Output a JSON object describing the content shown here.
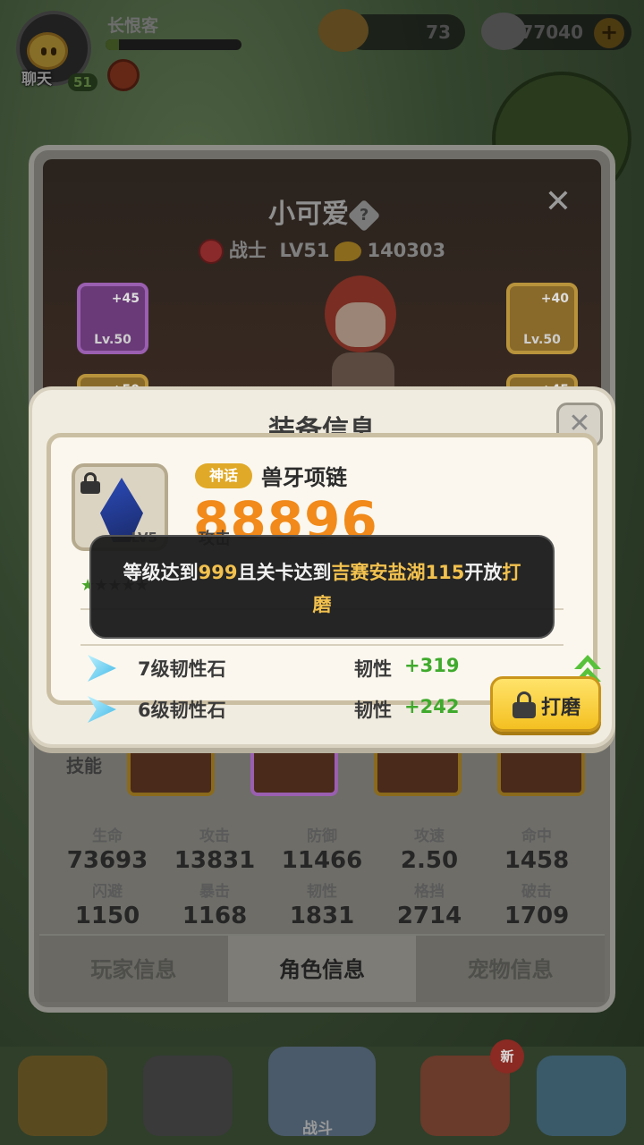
{
  "hud": {
    "player_name": "长恨客",
    "chat_label": "聊天",
    "player_level": "51",
    "exp_progress": 0.1,
    "gold": "73",
    "diamonds": "77040",
    "plus_symbol": "+"
  },
  "character": {
    "name": "小可爱",
    "help_symbol": "?",
    "class_name": "战士",
    "level": "LV51",
    "power": "140303",
    "close_symbol": "✕",
    "equip_left": {
      "bonus": "+45",
      "level": "Lv.50"
    },
    "equip_right": {
      "bonus": "+40",
      "level": "Lv.50"
    },
    "equip_left2": {
      "bonus": "+50"
    },
    "equip_right2": {
      "bonus": "+45"
    },
    "skill_label": "技能",
    "stats": [
      {
        "label": "生命",
        "value": "73693"
      },
      {
        "label": "攻击",
        "value": "13831"
      },
      {
        "label": "防御",
        "value": "11466"
      },
      {
        "label": "攻速",
        "value": "2.50"
      },
      {
        "label": "命中",
        "value": "1458"
      },
      {
        "label": "闪避",
        "value": "1150"
      },
      {
        "label": "暴击",
        "value": "1168"
      },
      {
        "label": "韧性",
        "value": "1831"
      },
      {
        "label": "格挡",
        "value": "2714"
      },
      {
        "label": "破击",
        "value": "1709"
      }
    ],
    "tabs": [
      "玩家信息",
      "角色信息",
      "宠物信息"
    ],
    "active_tab": 1
  },
  "bottom_nav": {
    "battle_label": "战斗",
    "new_badge": "新"
  },
  "dialog": {
    "title": "装备信息",
    "close_symbol": "✕",
    "item": {
      "rarity": "神话",
      "name": "兽牙项链",
      "power": "88896",
      "power_label": "攻击",
      "level": "LV5",
      "stars_filled": 1,
      "stars_total": 5
    },
    "gems": [
      {
        "name": "7级韧性石",
        "stat": "韧性",
        "value": "+319"
      },
      {
        "name": "6级韧性石",
        "stat": "韧性",
        "value": "+242"
      }
    ],
    "grind_label": "打磨"
  },
  "toast": {
    "part1": "等级达到",
    "level": "999",
    "part2": "且关卡达到",
    "stage": "吉赛安盐湖115",
    "part3": "开放",
    "feature": "打磨"
  },
  "colors": {
    "power_orange": "#f18a1a",
    "gem_green": "#3faa2c",
    "highlight_gold": "#f2c14e",
    "rarity_gold": "#e0a928"
  }
}
